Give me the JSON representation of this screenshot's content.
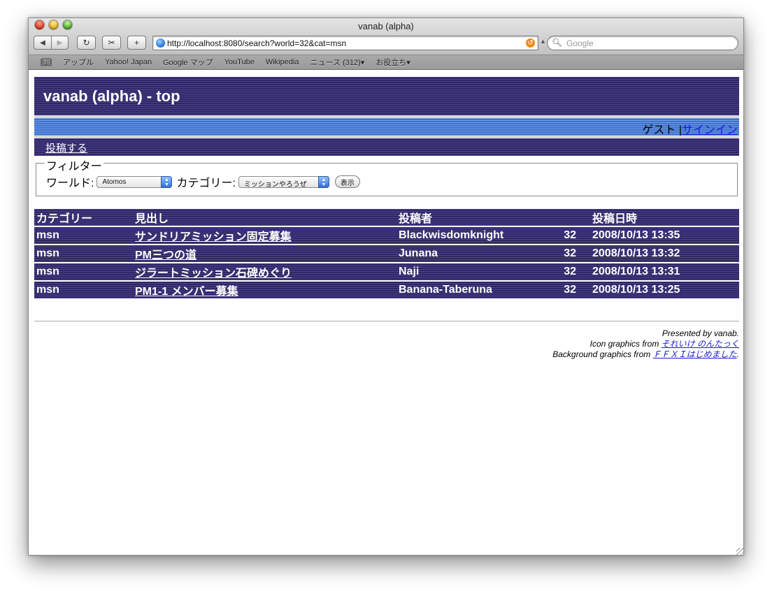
{
  "window": {
    "title": "vanab (alpha)"
  },
  "toolbar": {
    "back_label": "◀",
    "forward_label": "▶",
    "reload_label": "↻",
    "snippet_label": "✂",
    "add_label": "+",
    "url": "http://localhost:8080/search?world=32&cat=msn",
    "search_placeholder": "Google"
  },
  "bookmarks": [
    "アップル",
    "Yahoo! Japan",
    "Google マップ",
    "YouTube",
    "Wikipedia",
    "ニュース (312)▾",
    "お役立ち▾"
  ],
  "header": {
    "title": "vanab (alpha) - top"
  },
  "userbar": {
    "guest": "ゲスト |",
    "signin": "サインイン"
  },
  "postbar": {
    "post_link": "投稿する"
  },
  "filter": {
    "legend": "フィルター",
    "world_label": "ワールド:",
    "world_value": "Atomos",
    "category_label": "カテゴリー:",
    "category_value": "ミッションやろうぜ",
    "show_button": "表示"
  },
  "table": {
    "headers": {
      "category": "カテゴリー",
      "title": "見出し",
      "author": "投稿者",
      "count": "",
      "date": "投稿日時"
    },
    "rows": [
      {
        "category": "msn",
        "title": "サンドリアミッション固定募集",
        "author": "Blackwisdomknight",
        "count": "32",
        "date": "2008/10/13 13:35"
      },
      {
        "category": "msn",
        "title": "PM三つの道",
        "author": "Junana",
        "count": "32",
        "date": "2008/10/13 13:32"
      },
      {
        "category": "msn",
        "title": "ジラートミッション石碑めぐり",
        "author": "Naji",
        "count": "32",
        "date": "2008/10/13 13:31"
      },
      {
        "category": "msn",
        "title": "PM1-1 メンバー募集",
        "author": "Banana-Taberuna",
        "count": "32",
        "date": "2008/10/13 13:25"
      }
    ]
  },
  "credits": {
    "presented": "Presented by vanab.",
    "icon_prefix": "Icon graphics from ",
    "icon_link": "それいけ のんたっく",
    "bg_prefix": "Background graphics from ",
    "bg_link": "ＦＦＸＩはじめました",
    "bg_suffix": "."
  },
  "colors": {
    "header_bg": "#3d3376",
    "userbar_bg": "#4a7fd8",
    "link": "#1a1ad8"
  }
}
